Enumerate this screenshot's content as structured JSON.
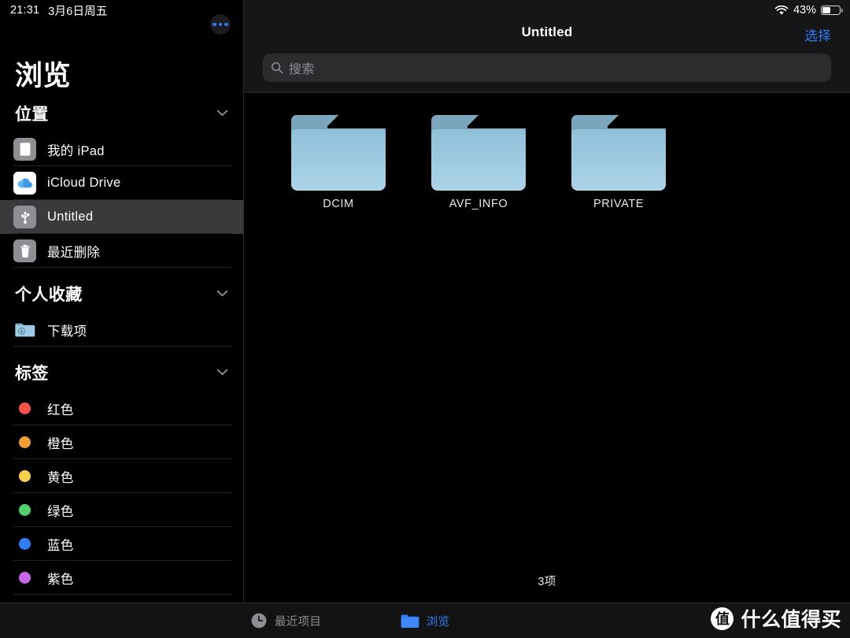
{
  "status_bar": {
    "time": "21:31",
    "date": "3月6日周五",
    "battery_percent": "43%",
    "battery_level": 43,
    "wifi_icon": "wifi-icon",
    "battery_icon": "battery-icon"
  },
  "sidebar": {
    "more_button_icon": "ellipsis-icon",
    "title": "浏览",
    "sections": [
      {
        "title": "位置",
        "chevron": "chevron-down-icon",
        "items": [
          {
            "label": "我的 iPad",
            "icon": "ipad-icon",
            "selected": false
          },
          {
            "label": "iCloud Drive",
            "icon": "icloud-icon",
            "selected": false
          },
          {
            "label": "Untitled",
            "icon": "usb-drive-icon",
            "selected": true
          },
          {
            "label": "最近删除",
            "icon": "trash-icon",
            "selected": false
          }
        ]
      },
      {
        "title": "个人收藏",
        "chevron": "chevron-down-icon",
        "items": [
          {
            "label": "下载项",
            "icon": "downloads-folder-icon",
            "selected": false
          }
        ]
      },
      {
        "title": "标签",
        "chevron": "chevron-down-icon",
        "items": [
          {
            "label": "红色",
            "icon": "tag-dot-icon",
            "color": "#f8534a",
            "selected": false
          },
          {
            "label": "橙色",
            "icon": "tag-dot-icon",
            "color": "#f0a030",
            "selected": false
          },
          {
            "label": "黄色",
            "icon": "tag-dot-icon",
            "color": "#f7d14a",
            "selected": false
          },
          {
            "label": "绿色",
            "icon": "tag-dot-icon",
            "color": "#52d06d",
            "selected": false
          },
          {
            "label": "蓝色",
            "icon": "tag-dot-icon",
            "color": "#2f7cf6",
            "selected": false
          },
          {
            "label": "紫色",
            "icon": "tag-dot-icon",
            "color": "#c濃"
          }
        ]
      }
    ]
  },
  "content": {
    "title": "Untitled",
    "select_label": "选择",
    "search": {
      "placeholder": "搜索",
      "value": "",
      "icon": "search-icon"
    },
    "items": [
      {
        "name": "DCIM",
        "icon": "folder-icon"
      },
      {
        "name": "AVF_INFO",
        "icon": "folder-icon"
      },
      {
        "name": "PRIVATE",
        "icon": "folder-icon"
      }
    ],
    "item_count_label": "3项"
  },
  "tab_bar": {
    "tabs": [
      {
        "label": "最近项目",
        "icon": "clock-icon",
        "active": false
      },
      {
        "label": "浏览",
        "icon": "folder-icon",
        "active": true
      }
    ]
  },
  "watermark": {
    "mark": "值",
    "text": "什么值得买"
  },
  "colors": {
    "accent": "#2f7cf6",
    "selected_row": "#3a3a3c",
    "header_bg": "#161618",
    "search_bg": "#2c2c2e",
    "background": "#000000"
  }
}
